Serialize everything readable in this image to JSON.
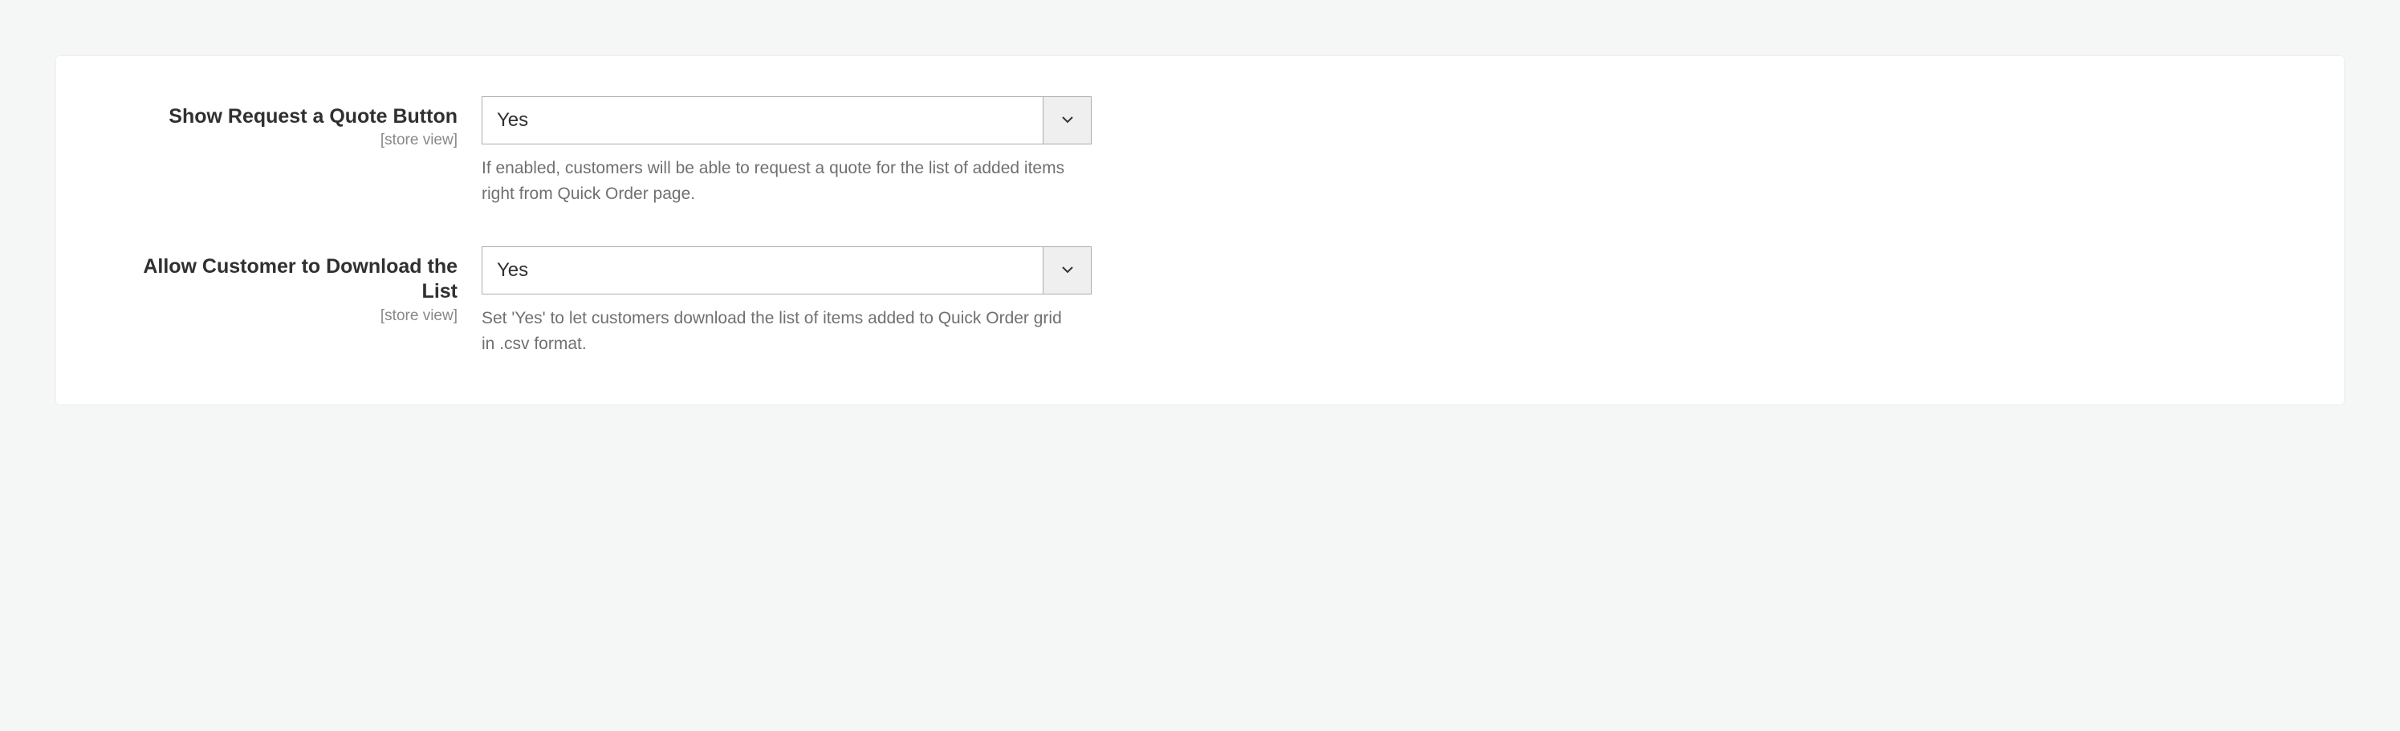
{
  "fields": [
    {
      "label": "Show Request a Quote Button",
      "scope": "[store view]",
      "value": "Yes",
      "help": "If enabled, customers will be able to request a quote for the list of added items right from Quick Order page."
    },
    {
      "label": "Allow Customer to Download the List",
      "scope": "[store view]",
      "value": "Yes",
      "help": "Set 'Yes' to let customers download the list of items added to Quick Order grid in .csv format."
    }
  ]
}
